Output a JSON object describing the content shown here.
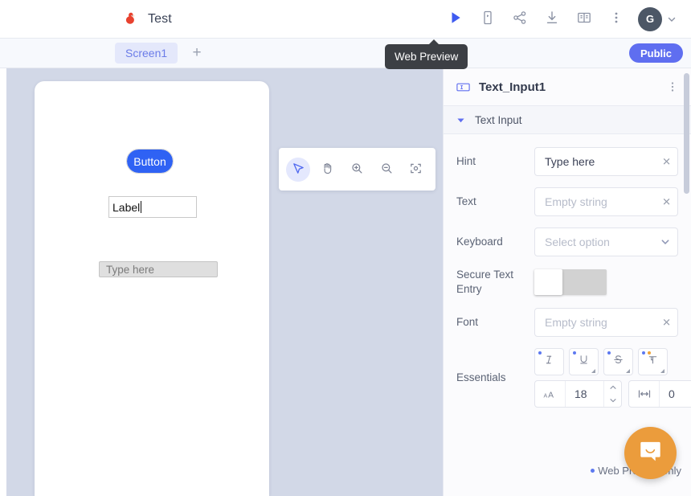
{
  "topbar": {
    "logo_icon": "app-logo-bird-icon",
    "app_title": "Test",
    "actions": [
      {
        "name": "web-preview-play-button",
        "icon": "play-icon"
      },
      {
        "name": "mobile-preview-button",
        "icon": "mobile-device-icon"
      },
      {
        "name": "share-button",
        "icon": "share-icon"
      },
      {
        "name": "download-button",
        "icon": "download-icon"
      },
      {
        "name": "documentation-button",
        "icon": "book-icon"
      },
      {
        "name": "more-options-button",
        "icon": "kebab-menu-icon"
      }
    ],
    "avatar_initial": "G",
    "avatar_caret_icon": "chevron-down-icon"
  },
  "tooltip": {
    "text": "Web Preview"
  },
  "screenbar": {
    "tabs": [
      {
        "label": "Screen1",
        "active": true
      }
    ],
    "add_label": "+",
    "visibility_badge": "Public"
  },
  "canvas": {
    "toolbar": [
      {
        "name": "select-tool",
        "icon": "cursor-arrow-icon",
        "active": true
      },
      {
        "name": "pan-tool",
        "icon": "hand-icon",
        "active": false
      },
      {
        "name": "zoom-in-tool",
        "icon": "zoom-in-icon",
        "active": false
      },
      {
        "name": "zoom-out-tool",
        "icon": "zoom-out-icon",
        "active": false
      },
      {
        "name": "fit-to-screen-tool",
        "icon": "fit-screen-icon",
        "active": false
      }
    ],
    "phone_components": {
      "button_label": "Button",
      "label_text": "Label",
      "input_placeholder": "Type here"
    }
  },
  "panel": {
    "header": {
      "icon": "text-input-icon",
      "title": "Text_Input1",
      "kebab_icon": "kebab-menu-icon"
    },
    "section": {
      "caret_icon": "caret-down-icon",
      "title": "Text Input"
    },
    "properties": [
      {
        "label": "Hint",
        "type": "text",
        "value": "Type here",
        "placeholder": "Empty string",
        "has_value": true,
        "clear_icon": "close-icon"
      },
      {
        "label": "Text",
        "type": "text",
        "value": "",
        "placeholder": "Empty string",
        "has_value": false,
        "clear_icon": "close-icon"
      },
      {
        "label": "Keyboard",
        "type": "select",
        "value": "",
        "placeholder": "Select option",
        "has_value": false,
        "caret_icon": "chevron-down-icon"
      },
      {
        "label": "Secure Text Entry",
        "type": "toggle",
        "checked": false
      },
      {
        "label": "Font",
        "type": "text",
        "value": "",
        "placeholder": "Empty string",
        "has_value": false,
        "clear_icon": "close-icon"
      }
    ],
    "essentials": {
      "label": "Essentials",
      "buttons": [
        {
          "name": "italic-button",
          "icon": "italic-icon",
          "dots": [
            "blue"
          ],
          "has_corner": false
        },
        {
          "name": "underline-button",
          "icon": "underline-icon",
          "dots": [
            "blue"
          ],
          "has_corner": true
        },
        {
          "name": "strikethrough-button",
          "icon": "strikethrough-icon",
          "dots": [
            "blue"
          ],
          "has_corner": true
        },
        {
          "name": "paragraph-format-button",
          "icon": "paragraph-icon",
          "dots": [
            "blue",
            "orange"
          ],
          "has_corner": true
        }
      ],
      "font_size": {
        "name": "font-size-stepper",
        "icon": "font-size-icon",
        "value": "18"
      },
      "letter_spacing": {
        "name": "letter-spacing-stepper",
        "icon": "letter-spacing-icon",
        "value": "0"
      }
    },
    "footnote": "Web Preview only"
  },
  "chat": {
    "fab_icon": "chat-bubble-icon"
  },
  "colors": {
    "accent_blue": "#5f6ef0",
    "canvas_bg": "#d2d8e7",
    "panel_bg": "#fbfbfd",
    "button_blue": "#2f62f4",
    "chat_orange": "#eb9c3c",
    "tooltip_bg": "#3c3f44"
  }
}
